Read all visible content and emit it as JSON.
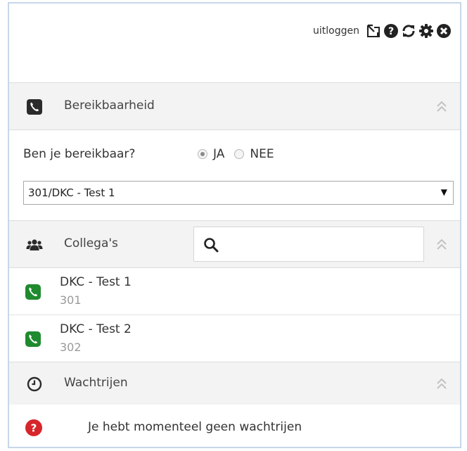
{
  "toolbar": {
    "logout_label": "uitloggen",
    "icons": [
      "external-window-icon",
      "help-icon",
      "refresh-icon",
      "settings-icon",
      "close-icon"
    ]
  },
  "availability": {
    "header": "Bereikbaarheid",
    "question": "Ben je bereikbaar?",
    "options": [
      {
        "label": "JA",
        "checked": true
      },
      {
        "label": "NEE",
        "checked": false
      }
    ],
    "select_value": "301/DKC - Test 1"
  },
  "colleagues": {
    "header": "Collega's",
    "search_placeholder": "",
    "items": [
      {
        "name": "DKC - Test 1",
        "number": "301"
      },
      {
        "name": "DKC - Test 2",
        "number": "302"
      }
    ]
  },
  "queues": {
    "header": "Wachtrijen",
    "empty_message": "Je hebt momenteel geen wachtrijen"
  },
  "colors": {
    "phone_green": "#1f8a2e",
    "alert_red": "#d6262b",
    "header_bg": "#f3f3f3",
    "frame_border": "#c7d7ea"
  }
}
